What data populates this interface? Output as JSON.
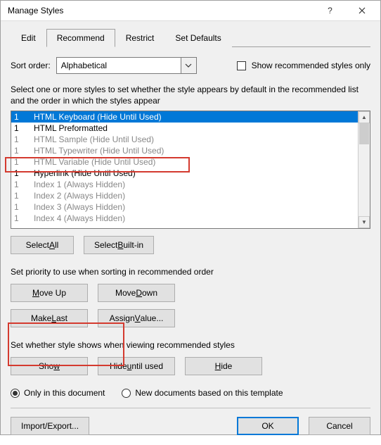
{
  "title": "Manage Styles",
  "tabs": {
    "edit": "Edit",
    "recommend": "Recommend",
    "restrict": "Restrict",
    "setdefaults": "Set Defaults",
    "active": "recommend"
  },
  "sort": {
    "label": "Sort order:",
    "value": "Alphabetical"
  },
  "show_recommended_only": {
    "label": "Show recommended styles only",
    "checked": false
  },
  "list_instruction": "Select one or more styles to set whether the style appears by default in the recommended list and the order in which the styles appear",
  "styles": [
    {
      "priority": "1",
      "name": "HTML Keyboard  (Hide Until Used)",
      "dim": false,
      "selected": true
    },
    {
      "priority": "1",
      "name": "HTML Preformatted",
      "dim": false,
      "selected": false
    },
    {
      "priority": "1",
      "name": "HTML Sample  (Hide Until Used)",
      "dim": true,
      "selected": false
    },
    {
      "priority": "1",
      "name": "HTML Typewriter  (Hide Until Used)",
      "dim": true,
      "selected": false
    },
    {
      "priority": "1",
      "name": "HTML Variable  (Hide Until Used)",
      "dim": true,
      "selected": false
    },
    {
      "priority": "1",
      "name": "Hyperlink  (Hide Until Used)",
      "dim": false,
      "selected": false
    },
    {
      "priority": "1",
      "name": "Index 1  (Always Hidden)",
      "dim": true,
      "selected": false
    },
    {
      "priority": "1",
      "name": "Index 2  (Always Hidden)",
      "dim": true,
      "selected": false
    },
    {
      "priority": "1",
      "name": "Index 3  (Always Hidden)",
      "dim": true,
      "selected": false
    },
    {
      "priority": "1",
      "name": "Index 4  (Always Hidden)",
      "dim": true,
      "selected": false
    }
  ],
  "buttons": {
    "select_all": "Select All",
    "select_builtin": "Select Built-in",
    "priority_label": "Set priority to use when sorting in recommended order",
    "move_up": "Move Up",
    "move_down": "Move Down",
    "make_last": "Make Last",
    "assign_value": "Assign Value...",
    "visibility_label": "Set whether style shows when viewing recommended styles",
    "show": "Show",
    "hide_until_used": "Hide until used",
    "hide": "Hide"
  },
  "scope": {
    "only_doc": "Only in this document",
    "new_docs": "New documents based on this template",
    "selected": "only_doc"
  },
  "footer": {
    "import_export": "Import/Export...",
    "ok": "OK",
    "cancel": "Cancel"
  }
}
